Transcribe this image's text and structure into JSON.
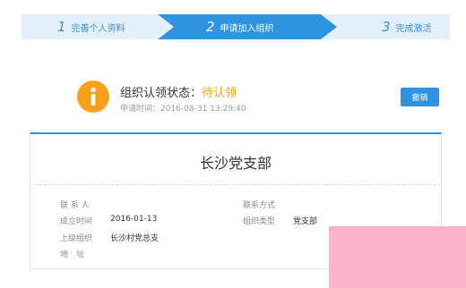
{
  "steps": [
    {
      "num": "1",
      "label": "完善个人资料"
    },
    {
      "num": "2",
      "label": "申请加入组织"
    },
    {
      "num": "3",
      "label": "完成激活"
    }
  ],
  "status": {
    "label": "组织认领状态：",
    "value": "待认领",
    "apply_time": "申请时间：2016-08-31 13:29:40",
    "revoke_label": "撤销",
    "icon": "info-icon",
    "icon_color": "#f5a11b"
  },
  "card": {
    "title": "长沙党支部",
    "fields": {
      "contact_label": "联 系 人",
      "contact_value": "",
      "contact_method_label": "联系方式",
      "contact_method_value": "",
      "founded_label": "成立时间",
      "founded_value": "2016-01-13",
      "org_type_label": "组织类型",
      "org_type_value": "党支部",
      "parent_label": "上级组织",
      "parent_value": "长沙村党总支",
      "address_label": "地　址",
      "address_value": ""
    }
  },
  "colors": {
    "accent": "#2f94e0",
    "warning": "#f5a11b",
    "step_inactive_bg": "#e3effa",
    "overlay": "#fbb3c9"
  }
}
